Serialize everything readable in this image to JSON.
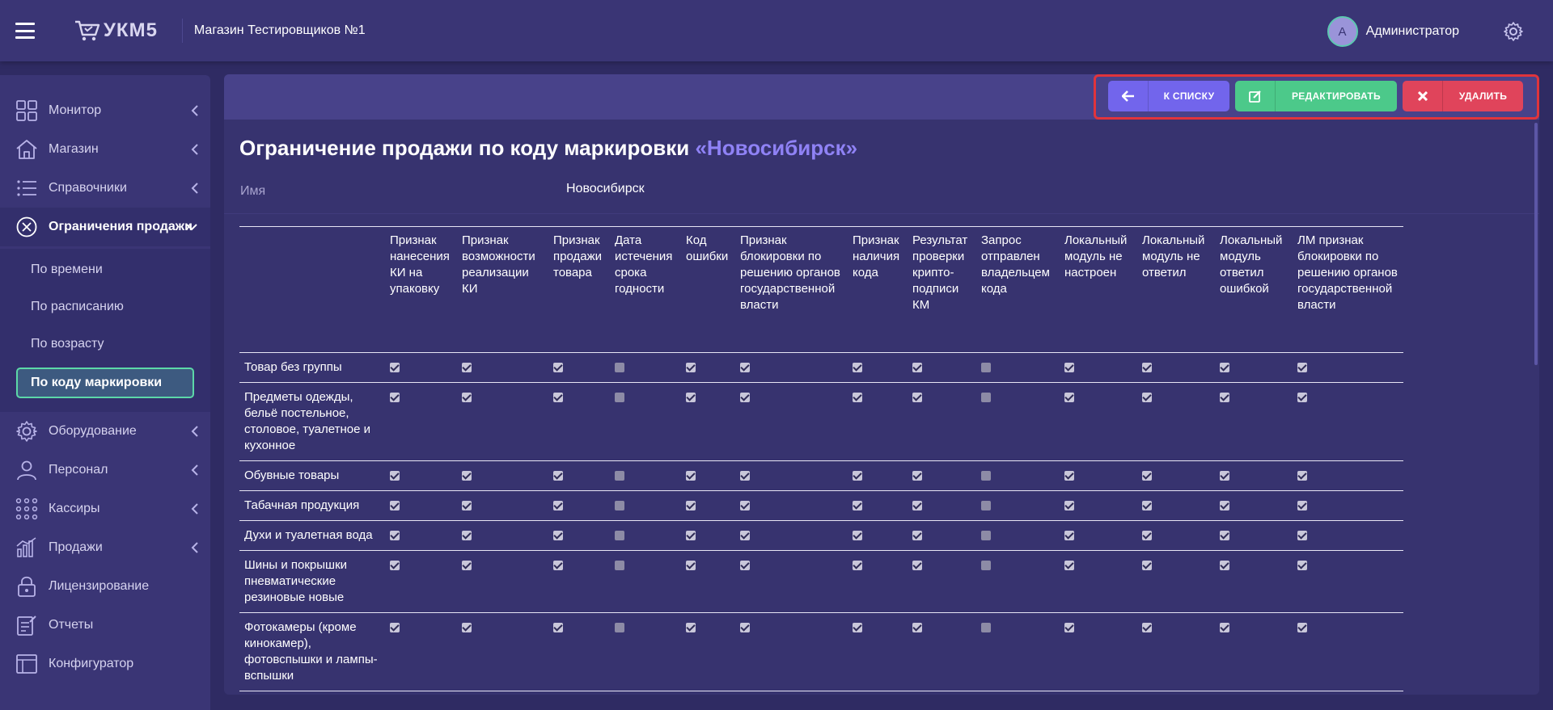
{
  "topbar": {
    "logo_text": "УКМ5",
    "store_name": "Магазин Тестировщиков №1",
    "user_initial": "A",
    "user_name": "Администратор"
  },
  "sidebar": {
    "items": [
      {
        "label": "Монитор",
        "icon": "monitor-icon"
      },
      {
        "label": "Магазин",
        "icon": "store-icon"
      },
      {
        "label": "Справочники",
        "icon": "list-icon"
      },
      {
        "label": "Ограничения продажи",
        "icon": "restriction-icon"
      },
      {
        "label": "Оборудование",
        "icon": "gear-icon"
      },
      {
        "label": "Персонал",
        "icon": "user-icon"
      },
      {
        "label": "Кассиры",
        "icon": "grid-dots-icon"
      },
      {
        "label": "Продажи",
        "icon": "chart-icon"
      },
      {
        "label": "Лицензирование",
        "icon": "lock-icon"
      },
      {
        "label": "Отчеты",
        "icon": "report-icon"
      },
      {
        "label": "Конфигуратор",
        "icon": "configurator-icon"
      }
    ],
    "submenu": [
      "По времени",
      "По расписанию",
      "По возрасту",
      "По коду маркировки"
    ]
  },
  "toolbar": {
    "back_label": "К СПИСКУ",
    "edit_label": "РЕДАКТИРОВАТЬ",
    "delete_label": "УДАЛИТЬ"
  },
  "page": {
    "title": "Ограничение продажи по коду маркировки",
    "title_accent": "«Новосибирск»",
    "name_label": "Имя",
    "name_value": "Новосибирск"
  },
  "table": {
    "columns": [
      "Признак нанесения КИ на упаковку",
      "Признак возможности реализации КИ",
      "Признак продажи товара",
      "Дата истечения срока годности",
      "Код ошибки",
      "Признак блокировки по решению органов государственной власти",
      "Признак наличия кода",
      "Результат проверки крипто-подписи КМ",
      "Запрос отправлен владельцем кода",
      "Локальный модуль не настроен",
      "Локальный модуль не ответил",
      "Локальный модуль ответил ошибкой",
      "ЛМ признак блокировки по решению органов государственной власти"
    ],
    "rows": [
      {
        "category": "Товар без группы",
        "checks": [
          1,
          1,
          1,
          0,
          1,
          1,
          1,
          1,
          0,
          1,
          1,
          1,
          1
        ]
      },
      {
        "category": "Предметы одежды, бельё постельное, столовое, туалетное и кухонное",
        "checks": [
          1,
          1,
          1,
          0,
          1,
          1,
          1,
          1,
          0,
          1,
          1,
          1,
          1
        ]
      },
      {
        "category": "Обувные товары",
        "checks": [
          1,
          1,
          1,
          0,
          1,
          1,
          1,
          1,
          0,
          1,
          1,
          1,
          1
        ]
      },
      {
        "category": "Табачная продукция",
        "checks": [
          1,
          1,
          1,
          0,
          1,
          1,
          1,
          1,
          0,
          1,
          1,
          1,
          1
        ]
      },
      {
        "category": "Духи и туалетная вода",
        "checks": [
          1,
          1,
          1,
          0,
          1,
          1,
          1,
          1,
          0,
          1,
          1,
          1,
          1
        ]
      },
      {
        "category": "Шины и покрышки пневматические резиновые новые",
        "checks": [
          1,
          1,
          1,
          0,
          1,
          1,
          1,
          1,
          0,
          1,
          1,
          1,
          1
        ]
      },
      {
        "category": "Фотокамеры (кроме кинокамер), фотовспышки и лампы-вспышки",
        "checks": [
          1,
          1,
          1,
          0,
          1,
          1,
          1,
          1,
          0,
          1,
          1,
          1,
          1
        ]
      }
    ]
  },
  "colors": {
    "background": "#2f2b63",
    "panel": "#37336f",
    "accent": "#8f82f5",
    "back_button": "#7265ec",
    "edit_button": "#4cc98a",
    "delete_button": "#e0445b",
    "highlight_border": "#e0343c"
  }
}
